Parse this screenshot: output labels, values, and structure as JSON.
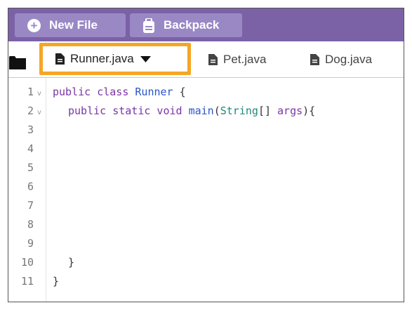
{
  "toolbar": {
    "new_file_label": "New File",
    "backpack_label": "Backpack"
  },
  "tabs": [
    {
      "label": "Runner.java",
      "active": true
    },
    {
      "label": "Pet.java",
      "active": false
    },
    {
      "label": "Dog.java",
      "active": false
    }
  ],
  "editor": {
    "line_numbers": [
      "1",
      "2",
      "3",
      "4",
      "5",
      "6",
      "7",
      "8",
      "9",
      "10",
      "11"
    ],
    "lines": {
      "l1_kw": "public class ",
      "l1_name": "Runner",
      "l1_rest": " {",
      "l2_kw": "public static void ",
      "l2_method": "main",
      "l2_paren": "(",
      "l2_type": "String",
      "l2_brackets": "[] ",
      "l2_arg": "args",
      "l2_rest": "){",
      "l10": "}",
      "l11": "}"
    }
  },
  "colors": {
    "toolbar_bg": "#7b62a6",
    "button_bg": "#9a88c5",
    "active_tab_border": "#f5a623",
    "keyword": "#7b35a8",
    "identifier": "#2a55c8",
    "type": "#1e8a7a"
  },
  "icons": {
    "new_file": "plus-circle-icon",
    "backpack": "backpack-icon",
    "folder": "folder-icon",
    "file": "file-icon",
    "dropdown": "caret-down-icon",
    "fold": "fold-chevron-icon"
  }
}
